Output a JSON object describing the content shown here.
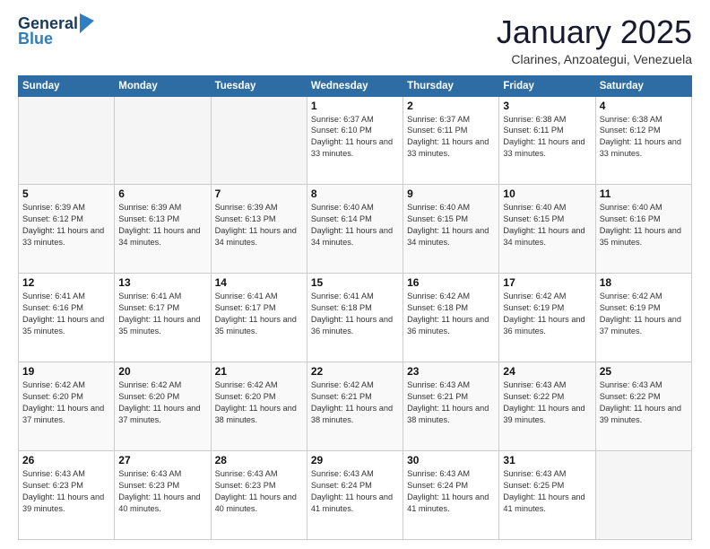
{
  "header": {
    "logo_general": "General",
    "logo_blue": "Blue",
    "month_title": "January 2025",
    "location": "Clarines, Anzoategui, Venezuela"
  },
  "days_of_week": [
    "Sunday",
    "Monday",
    "Tuesday",
    "Wednesday",
    "Thursday",
    "Friday",
    "Saturday"
  ],
  "weeks": [
    [
      {
        "day": "",
        "empty": true
      },
      {
        "day": "",
        "empty": true
      },
      {
        "day": "",
        "empty": true
      },
      {
        "day": "1",
        "sunrise": "6:37 AM",
        "sunset": "6:10 PM",
        "hours": "11 hours and 33 minutes."
      },
      {
        "day": "2",
        "sunrise": "6:37 AM",
        "sunset": "6:11 PM",
        "hours": "11 hours and 33 minutes."
      },
      {
        "day": "3",
        "sunrise": "6:38 AM",
        "sunset": "6:11 PM",
        "hours": "11 hours and 33 minutes."
      },
      {
        "day": "4",
        "sunrise": "6:38 AM",
        "sunset": "6:12 PM",
        "hours": "11 hours and 33 minutes."
      }
    ],
    [
      {
        "day": "5",
        "sunrise": "6:39 AM",
        "sunset": "6:12 PM",
        "hours": "11 hours and 33 minutes."
      },
      {
        "day": "6",
        "sunrise": "6:39 AM",
        "sunset": "6:13 PM",
        "hours": "11 hours and 34 minutes."
      },
      {
        "day": "7",
        "sunrise": "6:39 AM",
        "sunset": "6:13 PM",
        "hours": "11 hours and 34 minutes."
      },
      {
        "day": "8",
        "sunrise": "6:40 AM",
        "sunset": "6:14 PM",
        "hours": "11 hours and 34 minutes."
      },
      {
        "day": "9",
        "sunrise": "6:40 AM",
        "sunset": "6:15 PM",
        "hours": "11 hours and 34 minutes."
      },
      {
        "day": "10",
        "sunrise": "6:40 AM",
        "sunset": "6:15 PM",
        "hours": "11 hours and 34 minutes."
      },
      {
        "day": "11",
        "sunrise": "6:40 AM",
        "sunset": "6:16 PM",
        "hours": "11 hours and 35 minutes."
      }
    ],
    [
      {
        "day": "12",
        "sunrise": "6:41 AM",
        "sunset": "6:16 PM",
        "hours": "11 hours and 35 minutes."
      },
      {
        "day": "13",
        "sunrise": "6:41 AM",
        "sunset": "6:17 PM",
        "hours": "11 hours and 35 minutes."
      },
      {
        "day": "14",
        "sunrise": "6:41 AM",
        "sunset": "6:17 PM",
        "hours": "11 hours and 35 minutes."
      },
      {
        "day": "15",
        "sunrise": "6:41 AM",
        "sunset": "6:18 PM",
        "hours": "11 hours and 36 minutes."
      },
      {
        "day": "16",
        "sunrise": "6:42 AM",
        "sunset": "6:18 PM",
        "hours": "11 hours and 36 minutes."
      },
      {
        "day": "17",
        "sunrise": "6:42 AM",
        "sunset": "6:19 PM",
        "hours": "11 hours and 36 minutes."
      },
      {
        "day": "18",
        "sunrise": "6:42 AM",
        "sunset": "6:19 PM",
        "hours": "11 hours and 37 minutes."
      }
    ],
    [
      {
        "day": "19",
        "sunrise": "6:42 AM",
        "sunset": "6:20 PM",
        "hours": "11 hours and 37 minutes."
      },
      {
        "day": "20",
        "sunrise": "6:42 AM",
        "sunset": "6:20 PM",
        "hours": "11 hours and 37 minutes."
      },
      {
        "day": "21",
        "sunrise": "6:42 AM",
        "sunset": "6:20 PM",
        "hours": "11 hours and 38 minutes."
      },
      {
        "day": "22",
        "sunrise": "6:42 AM",
        "sunset": "6:21 PM",
        "hours": "11 hours and 38 minutes."
      },
      {
        "day": "23",
        "sunrise": "6:43 AM",
        "sunset": "6:21 PM",
        "hours": "11 hours and 38 minutes."
      },
      {
        "day": "24",
        "sunrise": "6:43 AM",
        "sunset": "6:22 PM",
        "hours": "11 hours and 39 minutes."
      },
      {
        "day": "25",
        "sunrise": "6:43 AM",
        "sunset": "6:22 PM",
        "hours": "11 hours and 39 minutes."
      }
    ],
    [
      {
        "day": "26",
        "sunrise": "6:43 AM",
        "sunset": "6:23 PM",
        "hours": "11 hours and 39 minutes."
      },
      {
        "day": "27",
        "sunrise": "6:43 AM",
        "sunset": "6:23 PM",
        "hours": "11 hours and 40 minutes."
      },
      {
        "day": "28",
        "sunrise": "6:43 AM",
        "sunset": "6:23 PM",
        "hours": "11 hours and 40 minutes."
      },
      {
        "day": "29",
        "sunrise": "6:43 AM",
        "sunset": "6:24 PM",
        "hours": "11 hours and 41 minutes."
      },
      {
        "day": "30",
        "sunrise": "6:43 AM",
        "sunset": "6:24 PM",
        "hours": "11 hours and 41 minutes."
      },
      {
        "day": "31",
        "sunrise": "6:43 AM",
        "sunset": "6:25 PM",
        "hours": "11 hours and 41 minutes."
      },
      {
        "day": "",
        "empty": true
      }
    ]
  ]
}
